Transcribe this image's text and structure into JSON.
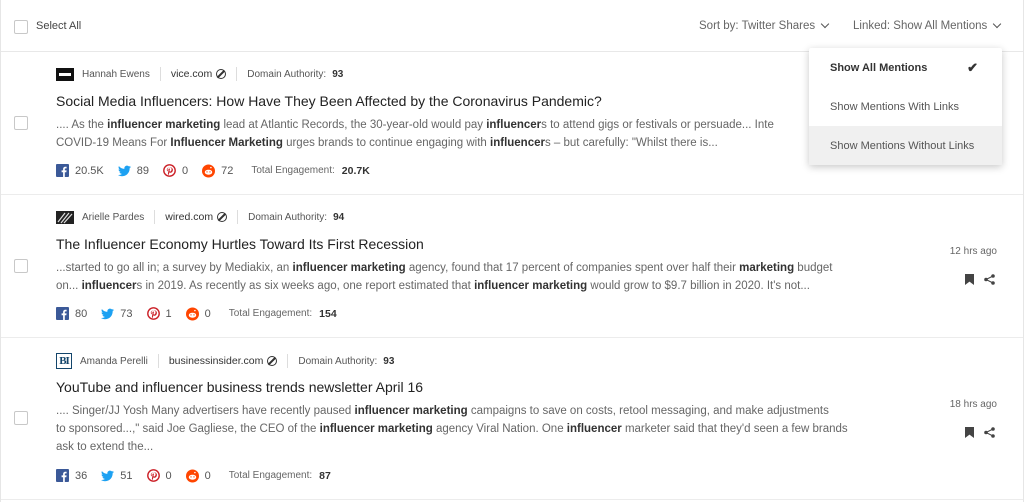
{
  "toolbar": {
    "select_all": "Select All",
    "sort_label": "Sort by: Twitter Shares",
    "linked_label": "Linked: Show All Mentions"
  },
  "dropdown": {
    "items": [
      {
        "label": "Show All Mentions",
        "selected": true
      },
      {
        "label": "Show Mentions With Links",
        "selected": false
      },
      {
        "label": "Show Mentions Without Links",
        "selected": false
      }
    ],
    "check": "✔"
  },
  "mentions": [
    {
      "author": "Hannah Ewens",
      "domain": "vice.com",
      "da_label": "Domain Authority:",
      "da": "93",
      "title": "Social Media Influencers: How Have They Been Affected by the Coronavirus Pandemic?",
      "snippet_html": ".... As the <b>influencer marketing</b> lead at Atlantic Records, the 30-year-old would pay <b>influencer</b>s to attend gigs or festivals or persuade... Inte<br>COVID-19 Means For <b>Influencer Marketing</b> urges brands to continue engaging with <b>influencer</b>s – but carefully: \"Whilst there is...",
      "facebook": "20.5K",
      "twitter": "89",
      "pinterest": "0",
      "reddit": "72",
      "te_label": "Total Engagement:",
      "te": "20.7K",
      "time": ""
    },
    {
      "author": "Arielle Pardes",
      "domain": "wired.com",
      "da_label": "Domain Authority:",
      "da": "94",
      "title": "The Influencer Economy Hurtles Toward Its First Recession",
      "snippet_html": "...started to go all in; a survey by Mediakix, an <b>influencer marketing</b> agency, found that 17 percent of companies spent over half their <b>marketing</b> budget<br>on... <b>influencer</b>s in 2019. As recently as six weeks ago, one report estimated that <b>influencer marketing</b> would grow to $9.7 billion in 2020. It's not...",
      "facebook": "80",
      "twitter": "73",
      "pinterest": "1",
      "reddit": "0",
      "te_label": "Total Engagement:",
      "te": "154",
      "time": "12 hrs ago"
    },
    {
      "author": "Amanda Perelli",
      "domain": "businessinsider.com",
      "da_label": "Domain Authority:",
      "da": "93",
      "title": "YouTube and influencer business trends newsletter April 16",
      "snippet_html": ".... Singer/JJ Yosh Many advertisers have recently paused <b>influencer marketing</b> campaigns to save on costs, retool messaging, and make adjustments<br>to sponsored...,\" said Joe Gagliese, the CEO of the <b>influencer marketing</b> agency Viral Nation.  One <b>influencer</b> marketer said that they'd seen a few brands<br>ask to extend the...",
      "facebook": "36",
      "twitter": "51",
      "pinterest": "0",
      "reddit": "0",
      "te_label": "Total Engagement:",
      "te": "87",
      "time": "18 hrs ago"
    }
  ],
  "logos": [
    "vice-logo",
    "wired-logo",
    "businessinsider-logo"
  ],
  "logo_text_bi": "BI",
  "colors": {
    "facebook": "#3b5998",
    "twitter": "#1da1f2",
    "pinterest": "#cb2027",
    "reddit": "#ff4500"
  },
  "icons": [
    "checkbox-icon",
    "chevron-down-icon",
    "ban-icon",
    "facebook-icon",
    "twitter-icon",
    "pinterest-icon",
    "reddit-icon",
    "bookmark-icon",
    "share-icon",
    "check-icon"
  ]
}
